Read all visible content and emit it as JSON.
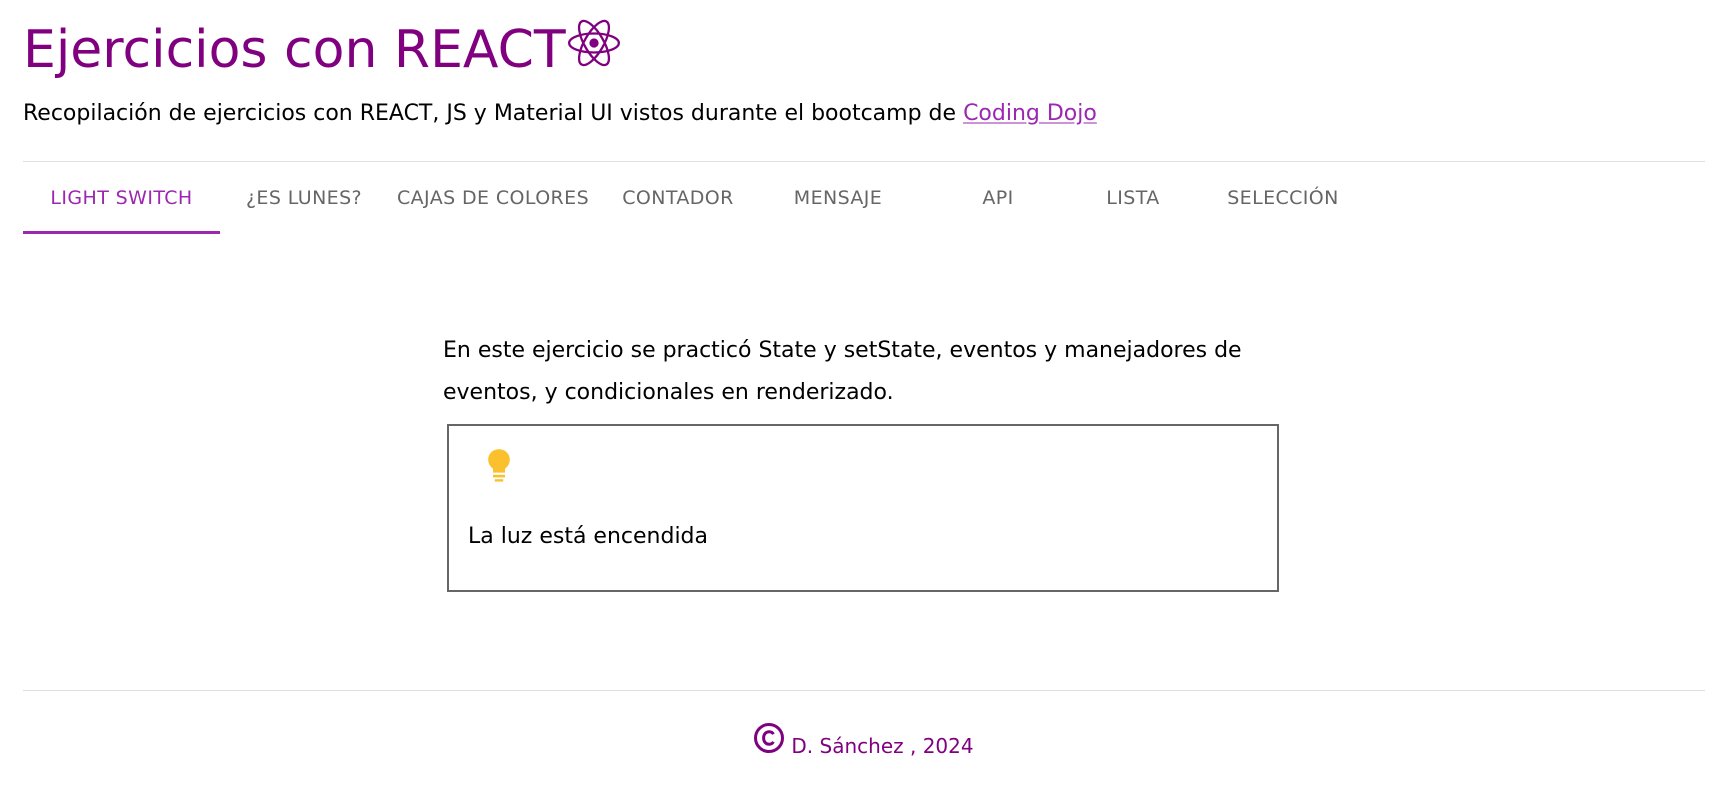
{
  "header": {
    "title": "Ejercicios con REACT",
    "subtitle_prefix": "Recopilación de ejercicios con REACT, JS y Material UI vistos durante el bootcamp de ",
    "subtitle_link": "Coding Dojo",
    "logo_icon": "react-atom-icon"
  },
  "tabs": [
    {
      "label": "LIGHT SWITCH",
      "active": true
    },
    {
      "label": "¿ES LUNES?",
      "active": false
    },
    {
      "label": "CAJAS DE COLORES",
      "active": false
    },
    {
      "label": "CONTADOR",
      "active": false
    },
    {
      "label": "MENSAJE",
      "active": false
    },
    {
      "label": "API",
      "active": false
    },
    {
      "label": "LISTA",
      "active": false
    },
    {
      "label": "SELECCIÓN",
      "active": false
    }
  ],
  "main": {
    "description": "En este ejercicio se practicó State y setState, eventos y manejadores de eventos, y condicionales en renderizado.",
    "light_status": "La luz está encendida",
    "bulb_icon": "lightbulb-icon",
    "bulb_color": "#fbc02d"
  },
  "footer": {
    "text": "D. Sánchez , 2024",
    "icon": "copyright-icon"
  },
  "colors": {
    "brand": "#800080",
    "accent": "#9c27b0",
    "tab_text": "#666666"
  }
}
